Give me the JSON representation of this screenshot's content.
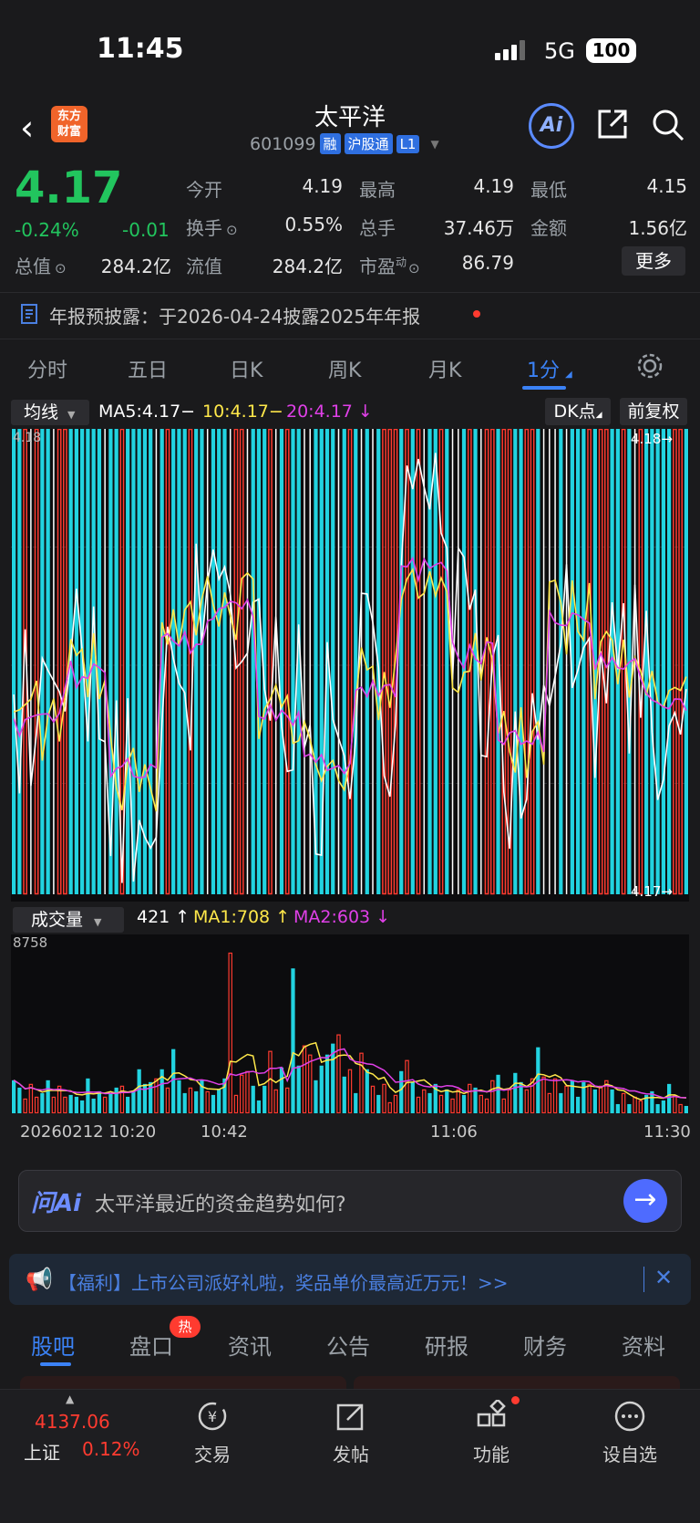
{
  "status": {
    "time": "11:45",
    "network": "5G",
    "battery": "100"
  },
  "header": {
    "name": "太平洋",
    "code": "601099",
    "tags": [
      "融",
      "沪股通",
      "L1"
    ],
    "logo_line1": "东方",
    "logo_line2": "财富",
    "ai_label": "Ai"
  },
  "quote": {
    "price": "4.17",
    "pct": "-0.24%",
    "chg": "-0.01",
    "open_label": "今开",
    "open": "4.19",
    "high_label": "最高",
    "high": "4.19",
    "low_label": "最低",
    "low": "4.15",
    "turnover_label": "换手",
    "turnover": "0.55%",
    "volume_label": "总手",
    "volume": "37.46万",
    "amount_label": "金额",
    "amount": "1.56亿",
    "mktcap_label": "总值",
    "mktcap": "284.2亿",
    "float_label": "流值",
    "float": "284.2亿",
    "pe_label": "市盈",
    "pe_sup": "动",
    "pe": "86.79",
    "more": "更多"
  },
  "notice": {
    "text": "年报预披露：于2026-04-24披露2025年年报"
  },
  "period_tabs": [
    "分时",
    "五日",
    "日K",
    "周K",
    "月K",
    "1分"
  ],
  "ma": {
    "selector": "均线",
    "ma5": "MA5:4.17−",
    "ma10": "10:4.17−",
    "ma20": "20:4.17",
    "dk": "DK点",
    "adjust": "前复权",
    "y_top": "4.18",
    "y_top_right": "4.18",
    "y_bottom_right": "4.17",
    "colors": {
      "ma5": "#ffffff",
      "ma10": "#ffe84a",
      "ma20": "#e040e8",
      "up": "#ff3b30",
      "down": "#22d3e0"
    }
  },
  "volume": {
    "selector": "成交量",
    "cur": "421",
    "ma1": "MA1:708",
    "ma2": "MA2:603",
    "max_label": "8758"
  },
  "time_axis": [
    "20260212 10:20",
    "10:42",
    "11:06",
    "11:30"
  ],
  "chart_data": {
    "type": "bar",
    "title": "",
    "ylim": [
      4.17,
      4.18
    ],
    "volume_max": 8758,
    "volume": [
      1800,
      1400,
      800,
      1600,
      900,
      1100,
      1800,
      900,
      1500,
      900,
      1000,
      900,
      700,
      1900,
      800,
      1200,
      900,
      1100,
      1400,
      1500,
      900,
      1200,
      2400,
      1600,
      1700,
      1900,
      2400,
      1400,
      3500,
      1800,
      1100,
      1400,
      1200,
      1800,
      1200,
      1000,
      1300,
      1900,
      8758,
      1000,
      2100,
      2300,
      1500,
      700,
      1500,
      3400,
      1300,
      2500,
      1400,
      7900,
      2600,
      3700,
      3200,
      1800,
      2600,
      3200,
      3800,
      4300,
      2000,
      2400,
      1100,
      3300,
      2400,
      1500,
      1000,
      1600,
      600,
      1000,
      2300,
      2900,
      1700,
      900,
      1300,
      1100,
      1600,
      1000,
      1300,
      800,
      1300,
      1000,
      1600,
      1400,
      1000,
      800,
      1800,
      2100,
      800,
      1300,
      2200,
      1700,
      1300,
      1900,
      3600,
      2000,
      1100,
      1900,
      1100,
      1500,
      1800,
      900,
      1700,
      1600,
      1300,
      1500,
      1800,
      1300,
      500,
      1100,
      500,
      900,
      700,
      1000,
      1200,
      500,
      700,
      1600,
      1000,
      500,
      400
    ]
  },
  "ask": {
    "logo": "问Ai",
    "text": "太平洋最近的资金趋势如何?"
  },
  "promo": {
    "text": "【福利】上市公司派好礼啦，奖品单价最高近万元！>>"
  },
  "sub_tabs": [
    "股吧",
    "盘口",
    "资讯",
    "公告",
    "研报",
    "财务",
    "资料"
  ],
  "hot_badge": "热",
  "bottom": {
    "index_value": "4137.06",
    "index_name": "上证",
    "index_pct": "0.12%",
    "nav": [
      "交易",
      "发帖",
      "功能",
      "设自选"
    ]
  }
}
